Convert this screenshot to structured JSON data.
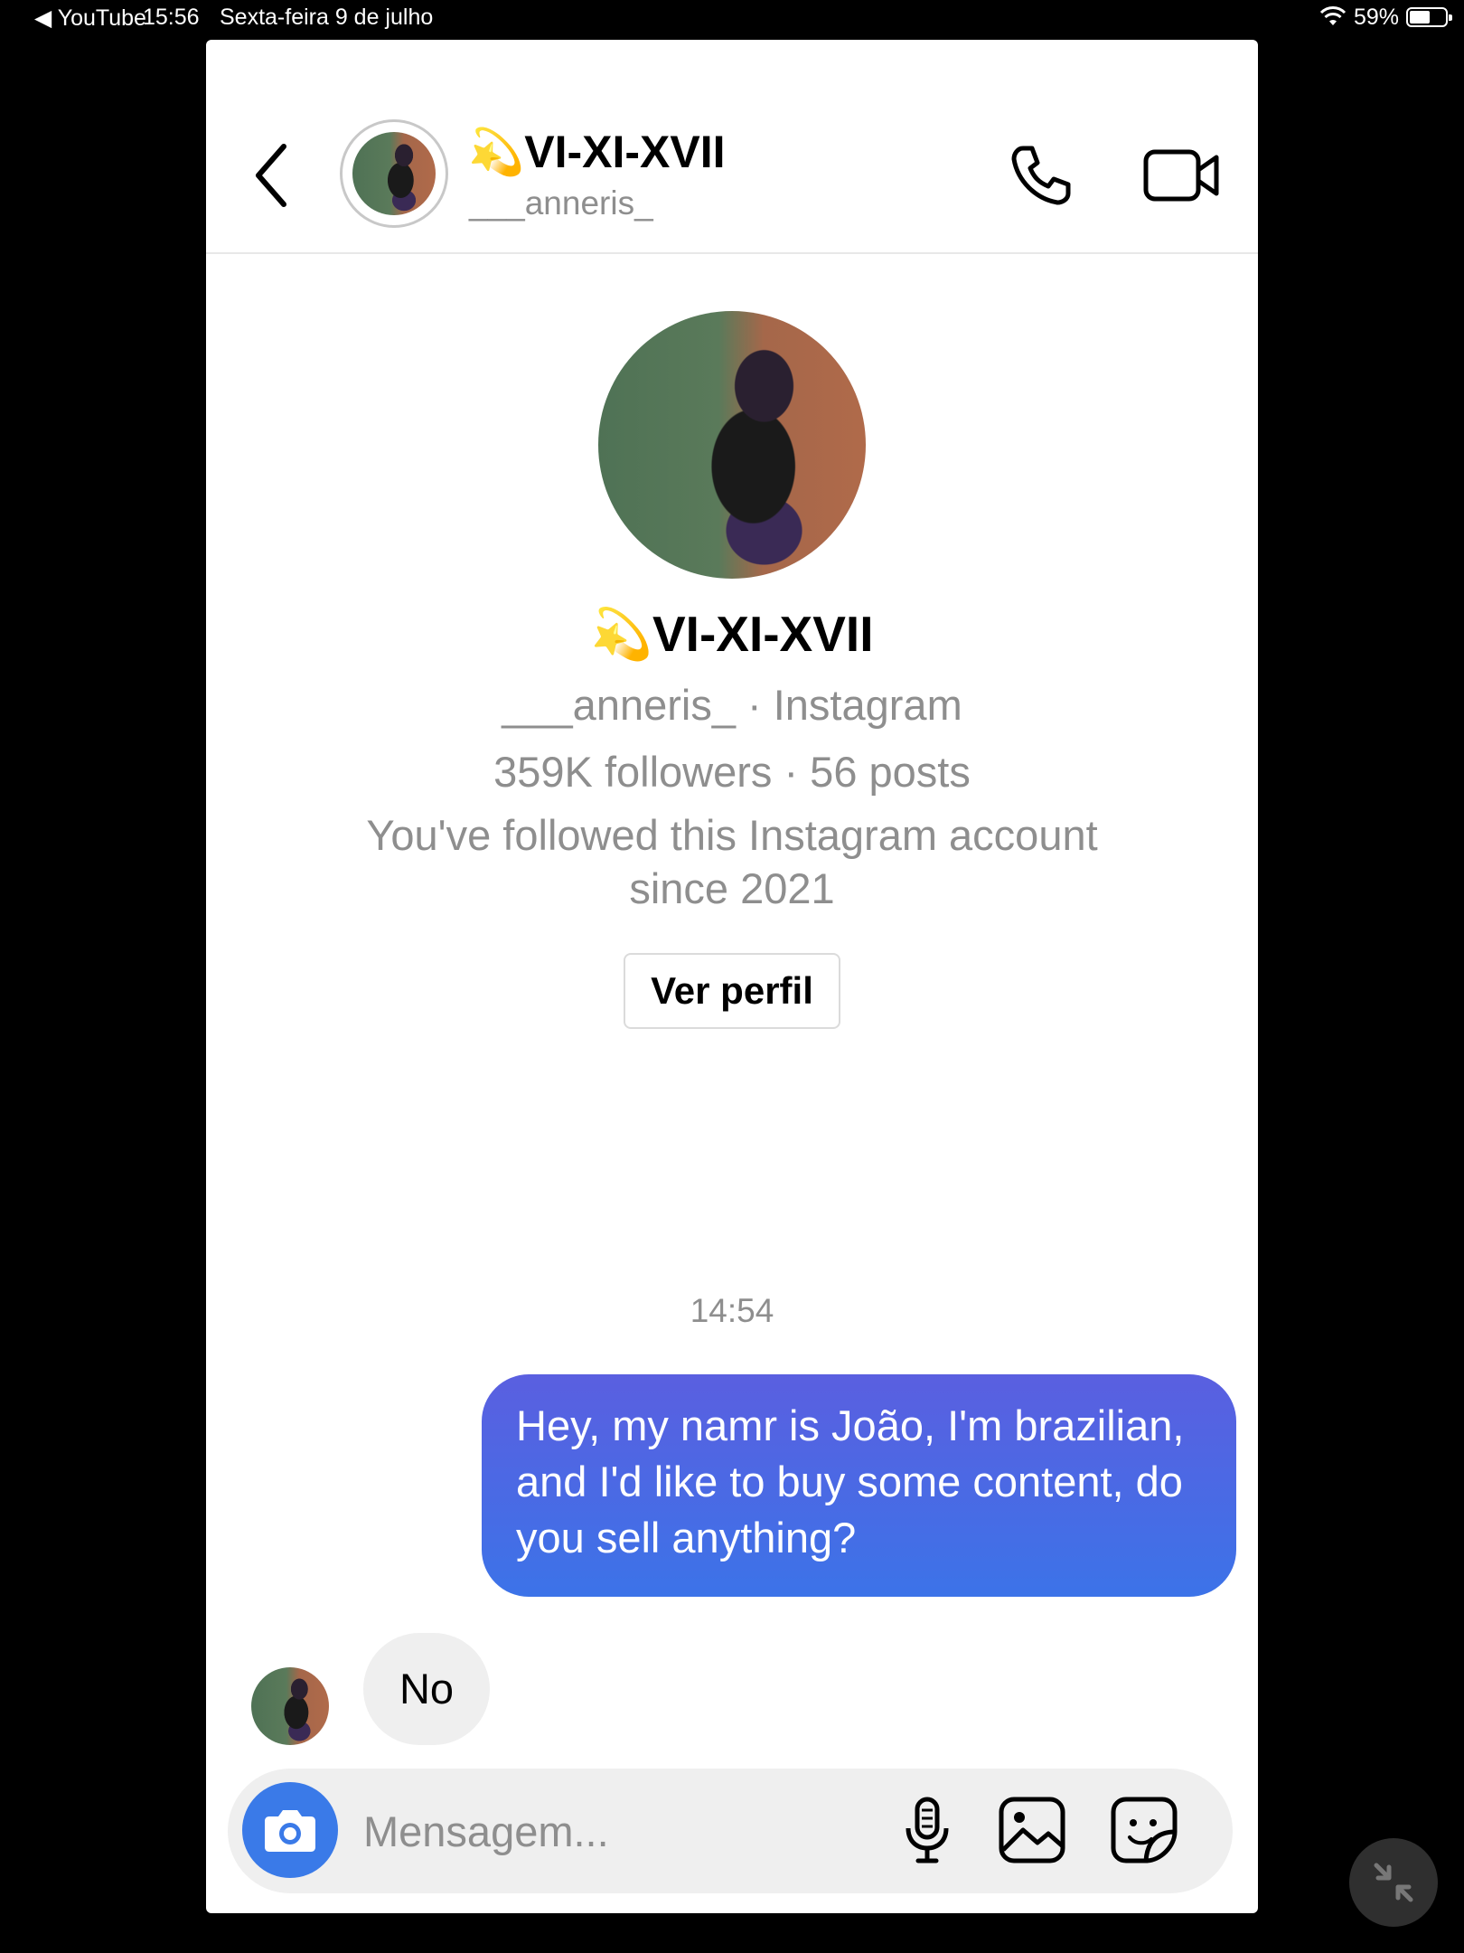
{
  "status_bar": {
    "back_app": "◀ YouTube",
    "time": "15:56",
    "date": "Sexta-feira 9 de julho",
    "battery": "59%",
    "battery_level": 0.59
  },
  "header": {
    "display_name": "💫VI-XI-XVII",
    "username": "___anneris_",
    "back_icon": "chevron-left-icon",
    "call_icon": "phone-icon",
    "video_icon": "video-camera-icon"
  },
  "profile_intro": {
    "display_name": "💫VI-XI-XVII",
    "subtitle": "___anneris_ · Instagram",
    "stats": "359K followers · 56 posts",
    "followed_note": "You've followed this Instagram account since 2021",
    "view_profile_label": "Ver perfil"
  },
  "conversation": {
    "timestamp": "14:54",
    "messages": [
      {
        "from": "me",
        "text": "Hey, my namr is João, I'm brazilian, and I'd like to buy some content, do you sell anything?"
      },
      {
        "from": "them",
        "text": "No"
      }
    ]
  },
  "composer": {
    "placeholder": "Mensagem...",
    "icons": [
      "camera-icon",
      "microphone-icon",
      "gallery-icon",
      "sticker-icon"
    ]
  },
  "colors": {
    "bubble_top": "#5a5fe0",
    "bubble_bottom": "#3c73e8",
    "camera_button": "#3a7ae8",
    "muted_text": "#8e8e8e"
  }
}
